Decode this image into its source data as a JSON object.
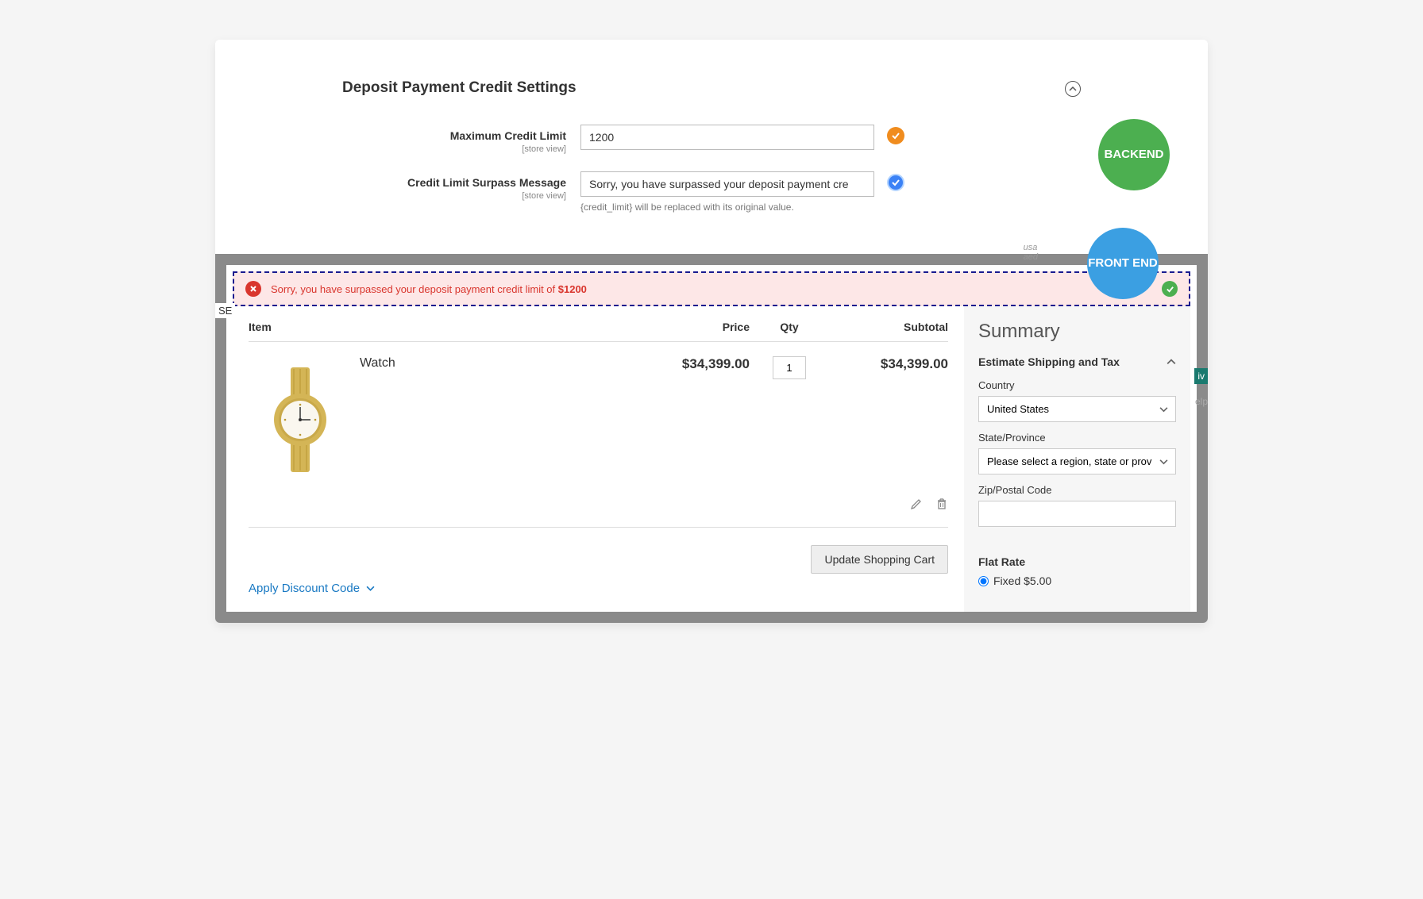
{
  "backend": {
    "title": "Deposit Payment Credit Settings",
    "badge": "BACKEND",
    "fields": {
      "max_limit": {
        "label": "Maximum Credit Limit",
        "scope": "[store view]",
        "value": "1200"
      },
      "surpass_msg": {
        "label": "Credit Limit Surpass Message",
        "scope": "[store view]",
        "value": "Sorry, you have surpassed your deposit payment cre",
        "hint": "{credit_limit} will be replaced with its original value."
      }
    }
  },
  "frontend": {
    "badge": "FRONT END",
    "fragments": {
      "se": "SE",
      "usa": "usa",
      "aed": "aed",
      "iv": "iv",
      "elp": "elp"
    },
    "error": {
      "text_prefix": "Sorry, you have surpassed your deposit payment credit limit of ",
      "limit": "$1200"
    },
    "cart": {
      "headers": {
        "item": "Item",
        "price": "Price",
        "qty": "Qty",
        "subtotal": "Subtotal"
      },
      "item": {
        "name": "Watch",
        "price": "$34,399.00",
        "qty": "1",
        "subtotal": "$34,399.00"
      },
      "update_btn": "Update Shopping Cart",
      "discount_link": "Apply Discount Code"
    },
    "summary": {
      "title": "Summary",
      "estimate_label": "Estimate Shipping and Tax",
      "country_label": "Country",
      "country_value": "United States",
      "state_label": "State/Province",
      "state_placeholder": "Please select a region, state or prov",
      "zip_label": "Zip/Postal Code",
      "flat_rate_title": "Flat Rate",
      "flat_rate_option": "Fixed $5.00"
    }
  }
}
